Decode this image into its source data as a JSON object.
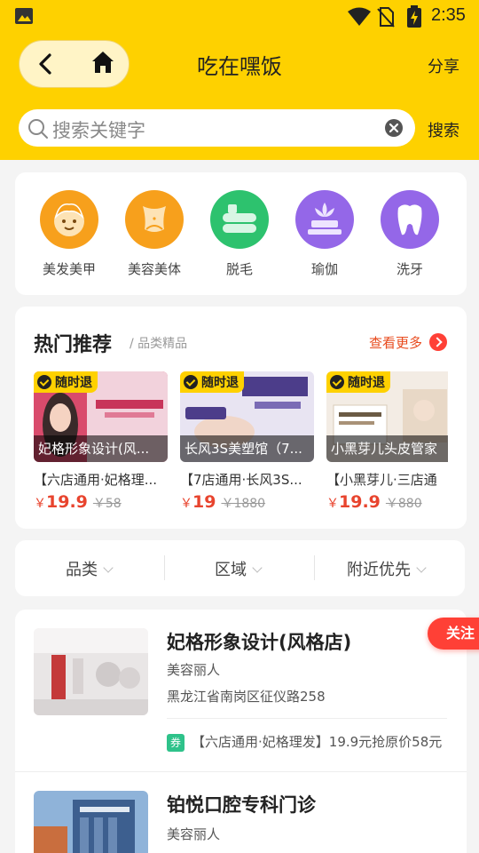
{
  "status_bar": {
    "time": "2:35"
  },
  "header": {
    "title": "吃在嘿饭",
    "share_label": "分享"
  },
  "search": {
    "placeholder": "搜索关键字",
    "button_label": "搜索"
  },
  "categories": [
    {
      "label": "美发美甲",
      "icon": "baby-face-icon",
      "color": "#f7a01c"
    },
    {
      "label": "美容美体",
      "icon": "body-shape-icon",
      "color": "#f7a01c"
    },
    {
      "label": "脱毛",
      "icon": "hair-removal-icon",
      "color": "#2dc26e"
    },
    {
      "label": "瑜伽",
      "icon": "lotus-yoga-icon",
      "color": "#9467e8"
    },
    {
      "label": "洗牙",
      "icon": "tooth-icon",
      "color": "#9467e8"
    }
  ],
  "hot": {
    "title": "热门推荐",
    "subtitle": "/ 品类精品",
    "more_label": "查看更多",
    "items": [
      {
        "tag": "随时退",
        "caption": "妃格形象设计(风...",
        "desc": "【六店通用·妃格理...",
        "currency": "￥",
        "price": "19.9",
        "original": "￥58"
      },
      {
        "tag": "随时退",
        "caption": "长风3S美塑馆（7...",
        "desc": "【7店通用·长风3S...",
        "currency": "￥",
        "price": "19",
        "original": "￥1880"
      },
      {
        "tag": "随时退",
        "caption": "小黑芽儿头皮管家",
        "desc": "【小黑芽儿·三店通",
        "currency": "￥",
        "price": "19.9",
        "original": "￥880"
      }
    ]
  },
  "filters": [
    {
      "label": "品类"
    },
    {
      "label": "区域"
    },
    {
      "label": "附近优先"
    }
  ],
  "shops": [
    {
      "name": "妃格形象设计(风格店)",
      "category": "美容丽人",
      "address": "黑龙江省南岗区征仪路258",
      "coupon_badge": "券",
      "coupon": "【六店通用·妃格理发】19.9元抢原价58元"
    },
    {
      "name": "铂悦口腔专科门诊",
      "category": "美容丽人"
    }
  ],
  "follow_label": "关注"
}
